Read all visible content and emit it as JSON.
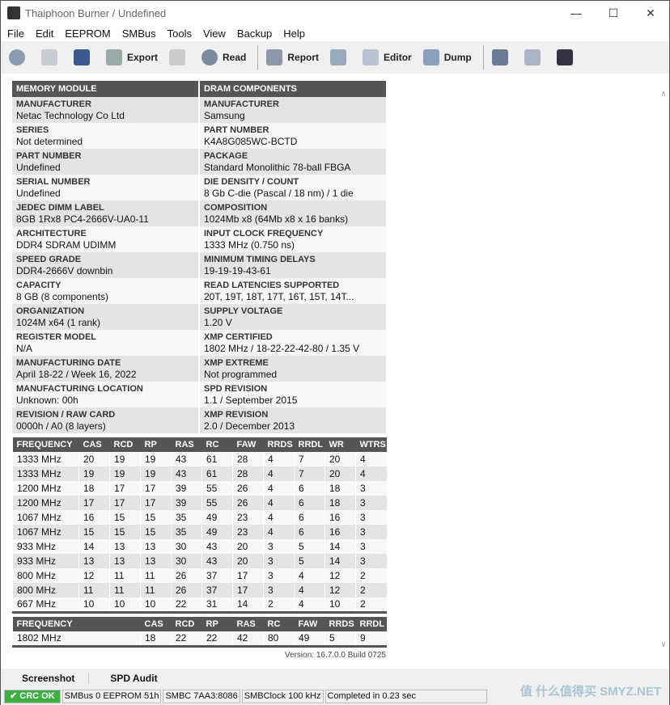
{
  "window": {
    "title": "Thaiphoon Burner / Undefined",
    "minimize": "—",
    "maximize": "☐",
    "close": "✕"
  },
  "menu": [
    "File",
    "Edit",
    "EEPROM",
    "SMBus",
    "Tools",
    "View",
    "Backup",
    "Help"
  ],
  "toolbar": {
    "export": "Export",
    "read": "Read",
    "report": "Report",
    "editor": "Editor",
    "dump": "Dump"
  },
  "info": {
    "left_header": "MEMORY MODULE",
    "right_header": "DRAM COMPONENTS",
    "left": [
      [
        "MANUFACTURER",
        "Netac Technology Co Ltd"
      ],
      [
        "SERIES",
        "Not determined"
      ],
      [
        "PART NUMBER",
        "Undefined"
      ],
      [
        "SERIAL NUMBER",
        "Undefined"
      ],
      [
        "JEDEC DIMM LABEL",
        "8GB 1Rx8 PC4-2666V-UA0-11"
      ],
      [
        "ARCHITECTURE",
        "DDR4 SDRAM UDIMM"
      ],
      [
        "SPEED GRADE",
        "DDR4-2666V downbin"
      ],
      [
        "CAPACITY",
        "8 GB (8 components)"
      ],
      [
        "ORGANIZATION",
        "1024M x64 (1 rank)"
      ],
      [
        "REGISTER MODEL",
        "N/A"
      ],
      [
        "MANUFACTURING DATE",
        "April 18-22 / Week 16, 2022"
      ],
      [
        "MANUFACTURING LOCATION",
        "Unknown: 00h"
      ],
      [
        "REVISION / RAW CARD",
        "0000h / A0 (8 layers)"
      ]
    ],
    "right": [
      [
        "MANUFACTURER",
        "Samsung"
      ],
      [
        "PART NUMBER",
        "K4A8G085WC-BCTD"
      ],
      [
        "PACKAGE",
        "Standard Monolithic 78-ball FBGA"
      ],
      [
        "DIE DENSITY / COUNT",
        "8 Gb C-die (Pascal / 18 nm) / 1 die"
      ],
      [
        "COMPOSITION",
        "1024Mb x8 (64Mb x8 x 16 banks)"
      ],
      [
        "INPUT CLOCK FREQUENCY",
        "1333 MHz (0.750 ns)"
      ],
      [
        "MINIMUM TIMING DELAYS",
        "19-19-19-43-61"
      ],
      [
        "READ LATENCIES SUPPORTED",
        "20T, 19T, 18T, 17T, 16T, 15T, 14T..."
      ],
      [
        "SUPPLY VOLTAGE",
        "1.20 V"
      ],
      [
        "XMP CERTIFIED",
        "1802 MHz / 18-22-22-42-80 / 1.35 V"
      ],
      [
        "XMP EXTREME",
        "Not programmed"
      ],
      [
        "SPD REVISION",
        "1.1 / September 2015"
      ],
      [
        "XMP REVISION",
        "2.0 / December 2013"
      ]
    ]
  },
  "timings": {
    "headers": [
      "FREQUENCY",
      "CAS",
      "RCD",
      "RP",
      "RAS",
      "RC",
      "FAW",
      "RRDS",
      "RRDL",
      "WR",
      "WTRS"
    ],
    "rows": [
      [
        "1333 MHz",
        "20",
        "19",
        "19",
        "43",
        "61",
        "28",
        "4",
        "7",
        "20",
        "4"
      ],
      [
        "1333 MHz",
        "19",
        "19",
        "19",
        "43",
        "61",
        "28",
        "4",
        "7",
        "20",
        "4"
      ],
      [
        "1200 MHz",
        "18",
        "17",
        "17",
        "39",
        "55",
        "26",
        "4",
        "6",
        "18",
        "3"
      ],
      [
        "1200 MHz",
        "17",
        "17",
        "17",
        "39",
        "55",
        "26",
        "4",
        "6",
        "18",
        "3"
      ],
      [
        "1067 MHz",
        "16",
        "15",
        "15",
        "35",
        "49",
        "23",
        "4",
        "6",
        "16",
        "3"
      ],
      [
        "1067 MHz",
        "15",
        "15",
        "15",
        "35",
        "49",
        "23",
        "4",
        "6",
        "16",
        "3"
      ],
      [
        "933 MHz",
        "14",
        "13",
        "13",
        "30",
        "43",
        "20",
        "3",
        "5",
        "14",
        "3"
      ],
      [
        "933 MHz",
        "13",
        "13",
        "13",
        "30",
        "43",
        "20",
        "3",
        "5",
        "14",
        "3"
      ],
      [
        "800 MHz",
        "12",
        "11",
        "11",
        "26",
        "37",
        "17",
        "3",
        "4",
        "12",
        "2"
      ],
      [
        "800 MHz",
        "11",
        "11",
        "11",
        "26",
        "37",
        "17",
        "3",
        "4",
        "12",
        "2"
      ],
      [
        "667 MHz",
        "10",
        "10",
        "10",
        "22",
        "31",
        "14",
        "2",
        "4",
        "10",
        "2"
      ]
    ]
  },
  "xmp": {
    "headers": [
      "FREQUENCY",
      "CAS",
      "RCD",
      "RP",
      "RAS",
      "RC",
      "FAW",
      "RRDS",
      "RRDL"
    ],
    "rows": [
      [
        "1802 MHz",
        "18",
        "22",
        "22",
        "42",
        "80",
        "49",
        "5",
        "9"
      ]
    ]
  },
  "version": "Version: 16.7.0.0 Build 0725",
  "tabs": [
    "Screenshot",
    "SPD Audit"
  ],
  "status": {
    "crc": "CRC OK",
    "bus": "SMBus 0 EEPROM 51h",
    "smbc": "SMBC 7AA3:8086",
    "clock": "SMBClock 100 kHz",
    "completed": "Completed in 0.23 sec"
  },
  "watermark": "值 什么值得买 SMYZ.NET"
}
